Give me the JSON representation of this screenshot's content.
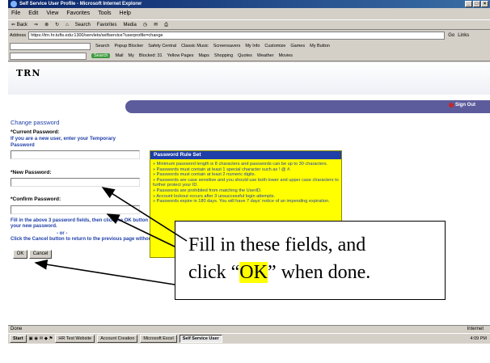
{
  "window": {
    "title": "Self Service User Profile - Microsoft Internet Explorer"
  },
  "menu": [
    "File",
    "Edit",
    "View",
    "Favorites",
    "Tools",
    "Help"
  ],
  "toolbar": {
    "back": "⇐ Back",
    "search": "Search",
    "favorites": "Favorites",
    "media": "Media"
  },
  "address": {
    "label": "Address",
    "url": "https://trn.hr.tufts.edu:1300/servlets/selfservice?userprofile=change",
    "go": "Go",
    "links": "Links"
  },
  "links_bar": {
    "search_button": "Search",
    "popup_blocker": "Popup Blocker",
    "items": [
      "Safety Central",
      "Classic Music",
      "Screensavers",
      "My Info",
      "Customize",
      "Games",
      "My Button"
    ]
  },
  "links_bar2": {
    "search_button": "Search",
    "items": [
      "Mail",
      "My",
      "Blocked: 31",
      "Yellow Pages",
      "Maps",
      "Shopping",
      "Quotes",
      "Weather",
      "Movies"
    ]
  },
  "page": {
    "logo": "TRN",
    "signout": "Sign Out",
    "title": "Change password",
    "current_label": "*Current Password:",
    "current_note": "If you are a new user, enter your Temporary Password",
    "new_label": "*New Password:",
    "confirm_label": "*Confirm Password:",
    "instructions": "Fill in the above 3 password fields, then click the OK button to save your new password.",
    "or": "- or -",
    "cancel_instructions": "Click the Cancel button to return to the previous page without Saving.",
    "ok_button": "OK",
    "cancel_button": "Cancel"
  },
  "rules": {
    "heading": "Password Rule Set",
    "items": [
      "» Minimum password length is 8 characters and passwords can be up to 30 characters.",
      "» Passwords must contain at least 1 special character such as ! @ #.",
      "» Passwords must contain at least 2 numeric digits.",
      "» Passwords are case sensitive and you should use both lower and upper case characters to further protect your ID.",
      "» Passwords are prohibited from matching the UserID.",
      "» Account lockout occurs after 3 unsuccessful login attempts.",
      "» Passwords expire in 180 days. You will have 7 days' notice of an impending expiration."
    ]
  },
  "status": {
    "left": "Done",
    "zone": "Internet"
  },
  "taskbar": {
    "start": "Start",
    "tasks": [
      "HR Test Website",
      "Account Creation",
      "Microsoft Excel",
      "Self Service User"
    ],
    "clock": "4:09 PM"
  },
  "callout": {
    "line1": "Fill in these fields, and",
    "line2_prefix": "click “",
    "line2_highlight": "OK",
    "line2_suffix": "” when done."
  },
  "colors": {
    "accent_blue": "#1f3fa8",
    "rules_yellow": "#ffff00",
    "header_purple": "#5c5c9c",
    "highlight": "#ffff00"
  }
}
